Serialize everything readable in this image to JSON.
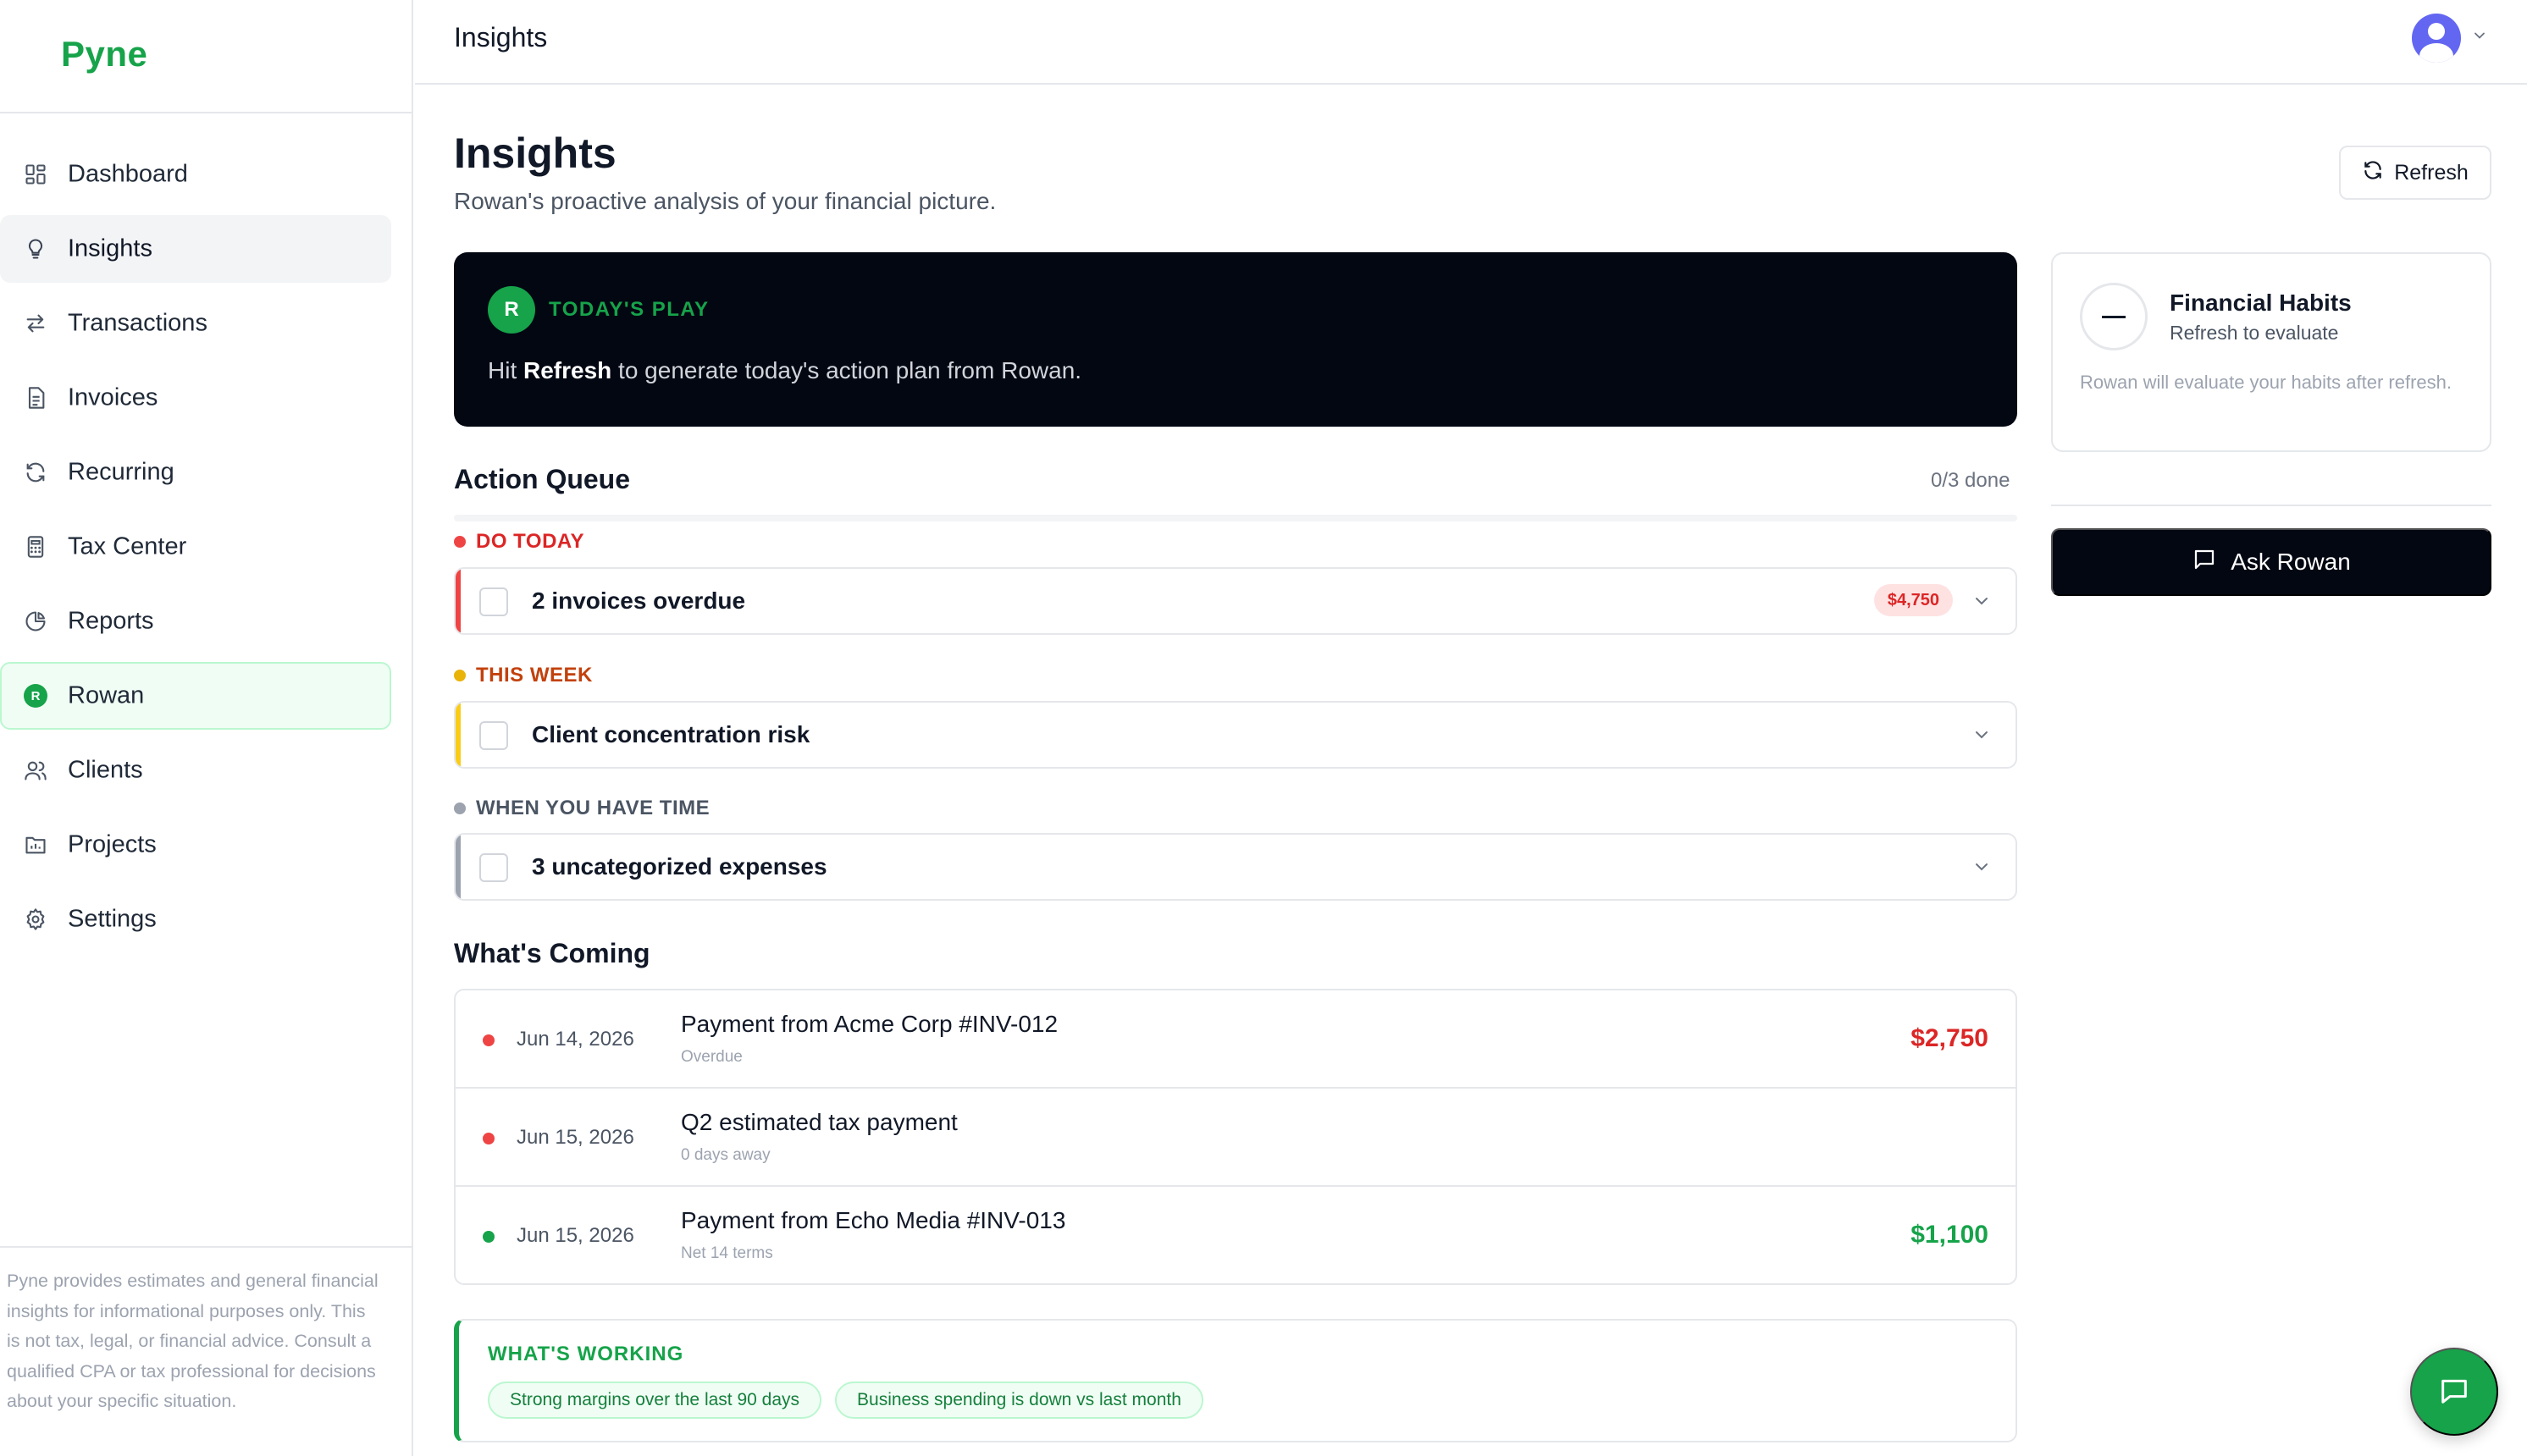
{
  "app": {
    "name": "Pyne"
  },
  "sidebar": {
    "items": [
      {
        "label": "Dashboard",
        "icon": "grid-icon"
      },
      {
        "label": "Insights",
        "icon": "lightbulb-icon"
      },
      {
        "label": "Transactions",
        "icon": "arrows-swap-icon"
      },
      {
        "label": "Invoices",
        "icon": "document-icon"
      },
      {
        "label": "Recurring",
        "icon": "refresh-icon"
      },
      {
        "label": "Tax Center",
        "icon": "calculator-icon"
      },
      {
        "label": "Reports",
        "icon": "pie-chart-icon"
      },
      {
        "label": "Rowan",
        "icon": "rowan-badge-icon",
        "badge": "R"
      },
      {
        "label": "Clients",
        "icon": "users-icon"
      },
      {
        "label": "Projects",
        "icon": "folder-chart-icon"
      },
      {
        "label": "Settings",
        "icon": "gear-icon"
      }
    ],
    "active": "Insights",
    "disclaimer": "Pyne provides estimates and general financial insights for informational purposes only. This is not tax, legal, or financial advice. Consult a qualified CPA or tax professional for decisions about your specific situation."
  },
  "topbar": {
    "title": "Insights"
  },
  "header": {
    "title": "Insights",
    "subtitle": "Rowan's proactive analysis of your financial picture.",
    "refresh_label": "Refresh"
  },
  "todays_play": {
    "badge": "R",
    "label": "TODAY'S PLAY",
    "text_before": "Hit ",
    "text_bold": "Refresh",
    "text_after": " to generate today's action plan from Rowan."
  },
  "action_queue": {
    "title": "Action Queue",
    "count": "0/3 done",
    "progress": 0,
    "groups": [
      {
        "label": "DO TODAY",
        "color": "#dc2626",
        "dot": "#ef4444",
        "task": "2 invoices overdue",
        "amount": "$4,750"
      },
      {
        "label": "THIS WEEK",
        "color": "#c2410c",
        "dot": "#eab308",
        "task": "Client concentration risk"
      },
      {
        "label": "WHEN YOU HAVE TIME",
        "color": "#4b5563",
        "dot": "#9ca3af",
        "task": "3 uncategorized expenses"
      }
    ]
  },
  "whats_coming": {
    "title": "What's Coming",
    "rows": [
      {
        "date": "Jun 14, 2026",
        "name": "Payment from Acme Corp #INV-012",
        "sub": "Overdue",
        "amount": "$2,750",
        "dot": "#ef4444",
        "amount_color": "#dc2626"
      },
      {
        "date": "Jun 15, 2026",
        "name": "Q2 estimated tax payment",
        "sub": "0 days away",
        "amount": "",
        "dot": "#ef4444",
        "amount_color": "#dc2626"
      },
      {
        "date": "Jun 15, 2026",
        "name": "Payment from Echo Media #INV-013",
        "sub": "Net 14 terms",
        "amount": "$1,100",
        "dot": "#16a34a",
        "amount_color": "#16a34a"
      }
    ]
  },
  "whats_working": {
    "label": "WHAT'S WORKING",
    "chips": [
      "Strong margins over the last 90 days",
      "Business spending is down vs last month"
    ]
  },
  "habits": {
    "title": "Financial Habits",
    "subtitle": "Refresh to evaluate",
    "note": "Rowan will evaluate your habits after refresh."
  },
  "ask": {
    "label": "Ask Rowan"
  },
  "colors": {
    "brand": "#16a34a",
    "dark": "#030712"
  }
}
